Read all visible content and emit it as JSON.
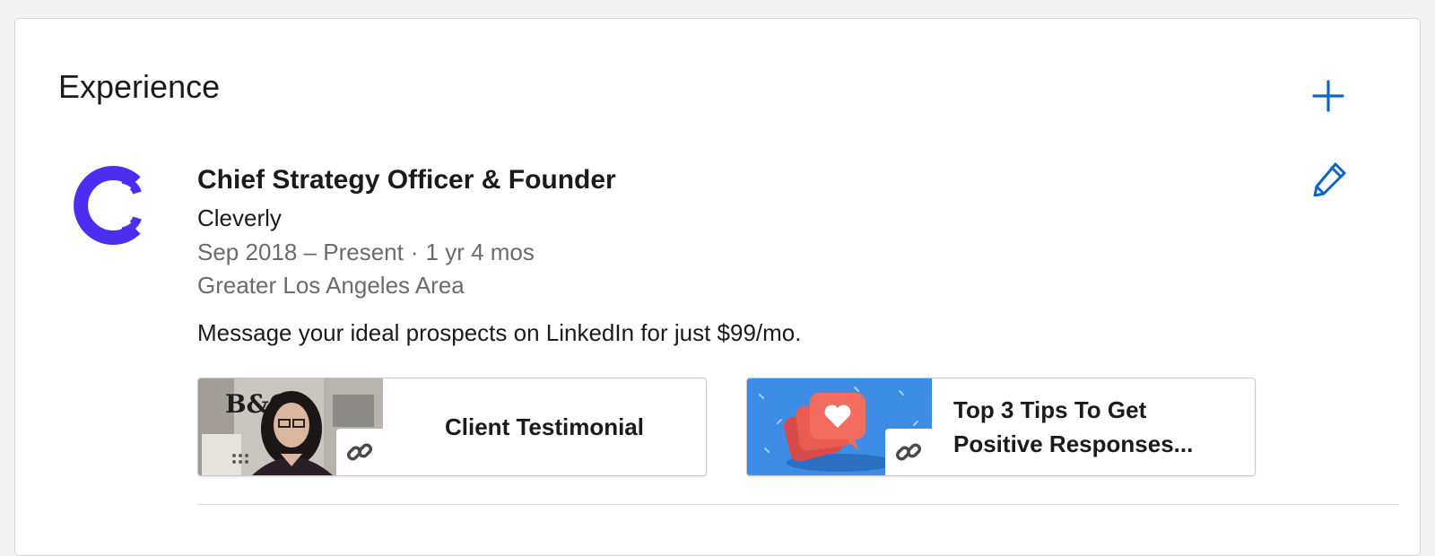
{
  "section": {
    "title": "Experience",
    "add_icon": "plus-icon",
    "edit_icon": "pencil-icon",
    "accent_color": "#0a66c2"
  },
  "experience": {
    "logo_icon": "cleverly-logo",
    "logo_color": "#4b2ef0",
    "title": "Chief Strategy Officer & Founder",
    "company": "Cleverly",
    "date_range": "Sep 2018 – Present",
    "date_separator": "·",
    "duration": "1 yr 4 mos",
    "location": "Greater Los Angeles Area",
    "description": "Message your ideal prospects on LinkedIn for just $99/mo.",
    "media": [
      {
        "label": "Client Testimonial",
        "icon": "link-icon",
        "thumb_text": "B&CO"
      },
      {
        "label": "Top 3 Tips To Get Positive Responses...",
        "icon": "link-icon"
      }
    ]
  }
}
